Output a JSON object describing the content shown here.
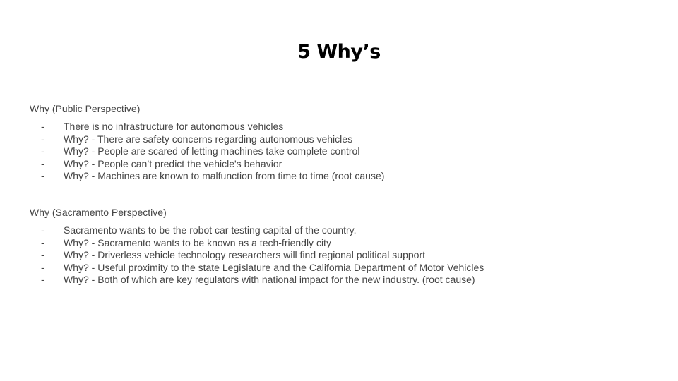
{
  "slide": {
    "title": "5 Why’s",
    "bullet_marker": "-",
    "sections": [
      {
        "heading": "Why (Public Perspective)",
        "items": [
          "There is no infrastructure for autonomous vehicles",
          "Why? - There are safety concerns regarding autonomous vehicles",
          "Why? - People are scared of letting machines take complete control",
          "Why? - People can’t predict the vehicle's behavior",
          "Why? - Machines are known to malfunction from time to time (root cause)"
        ]
      },
      {
        "heading": "Why (Sacramento Perspective)",
        "items": [
          "Sacramento wants to be the robot car testing capital of the country.",
          "Why? - Sacramento wants to be known as a tech-friendly city",
          "Why? - Driverless vehicle technology researchers will find regional political support",
          "Why? - Useful proximity to the state Legislature and the California Department of Motor Vehicles",
          "Why? - Both of which are key regulators with national impact for the new industry. (root cause)"
        ]
      }
    ]
  }
}
